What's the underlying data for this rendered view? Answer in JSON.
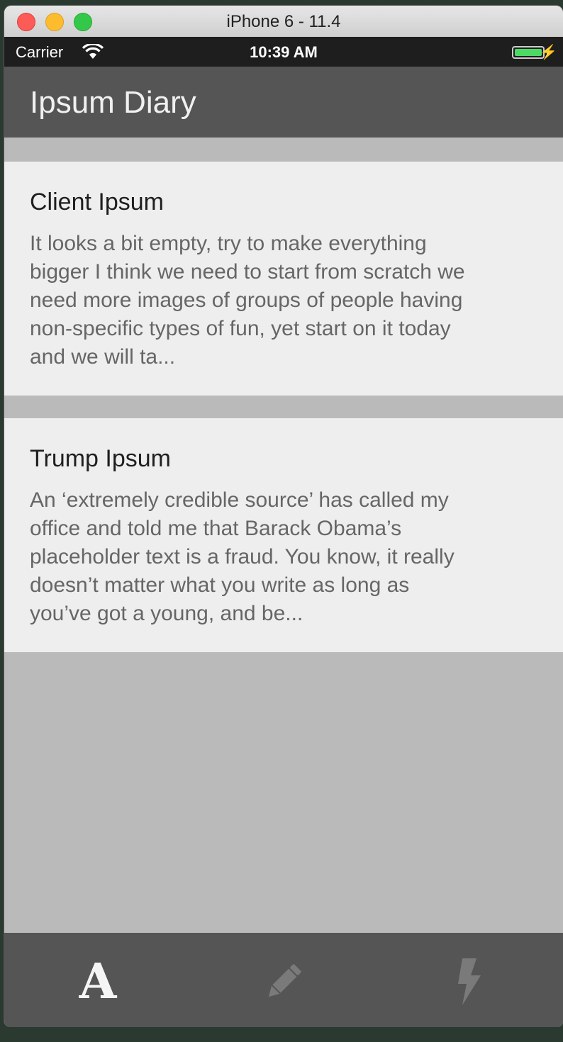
{
  "window": {
    "title": "iPhone 6 - 11.4"
  },
  "status_bar": {
    "carrier": "Carrier",
    "time": "10:39 AM",
    "battery_level": 1.0,
    "charging": true
  },
  "nav": {
    "title": "Ipsum Diary"
  },
  "entries": [
    {
      "title": "Client Ipsum",
      "body_lines": [
        "It looks a bit empty, try to make everything",
        "bigger I think we need to start from scratch we",
        "need more images of groups of people having",
        "non-specific types of fun, yet start on it today",
        "and we will ta..."
      ]
    },
    {
      "title": "Trump Ipsum",
      "body_lines": [
        "An ‘extremely credible source’ has called my",
        "office and told me that Barack Obama’s",
        "placeholder text is a fraud. You know, it really",
        "doesn’t matter what you write as long as",
        "you’ve got a young, and be..."
      ]
    }
  ],
  "tabbar": {
    "items": [
      {
        "icon": "letter-a-icon",
        "glyph": "A",
        "selected": true
      },
      {
        "icon": "pencil-icon",
        "selected": false
      },
      {
        "icon": "lightning-icon",
        "selected": false
      }
    ]
  },
  "colors": {
    "nav_background": "#555555",
    "list_background": "#bababa",
    "card_background": "#eeeeee",
    "battery": "#4cd964"
  }
}
